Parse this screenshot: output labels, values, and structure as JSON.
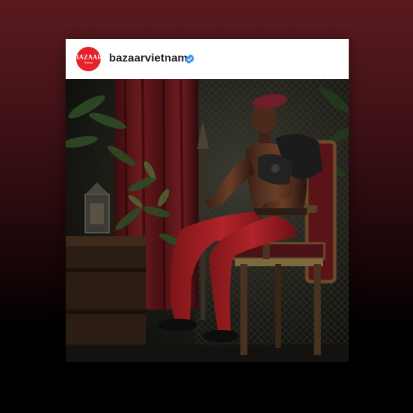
{
  "post": {
    "account": {
      "username": "bazaarvietnam",
      "verified": true,
      "avatar_logo": "BAZAAR",
      "avatar_sub": "Vietnam",
      "avatar_color": "#e5212b",
      "verified_color": "#3897f0"
    },
    "photo": {
      "icon": "portrait-photo"
    }
  },
  "background": {
    "top_color": "#5a1a1f",
    "bottom_color": "#000000"
  }
}
